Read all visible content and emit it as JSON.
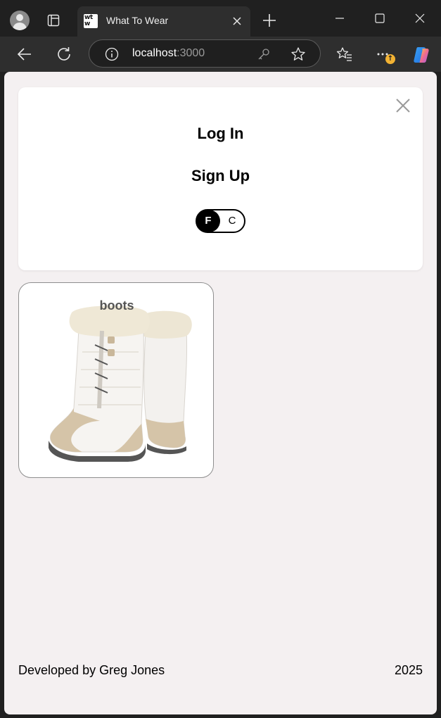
{
  "browser": {
    "tab_title": "What To Wear",
    "favicon_text": "wt w",
    "url_host": "localhost",
    "url_port": ":3000",
    "update_badge": "↑"
  },
  "header": {
    "login_label": "Log In",
    "signup_label": "Sign Up",
    "temp_toggle": {
      "f_label": "F",
      "c_label": "C",
      "selected": "F"
    }
  },
  "items": [
    {
      "name": "boots"
    }
  ],
  "footer": {
    "developer": "Developed by Greg Jones",
    "year": "2025"
  },
  "colors": {
    "page_bg": "#f4f0f1",
    "card_bg": "#ffffff",
    "chrome_bg": "#202020",
    "toolbar_bg": "#2e2e2e"
  }
}
